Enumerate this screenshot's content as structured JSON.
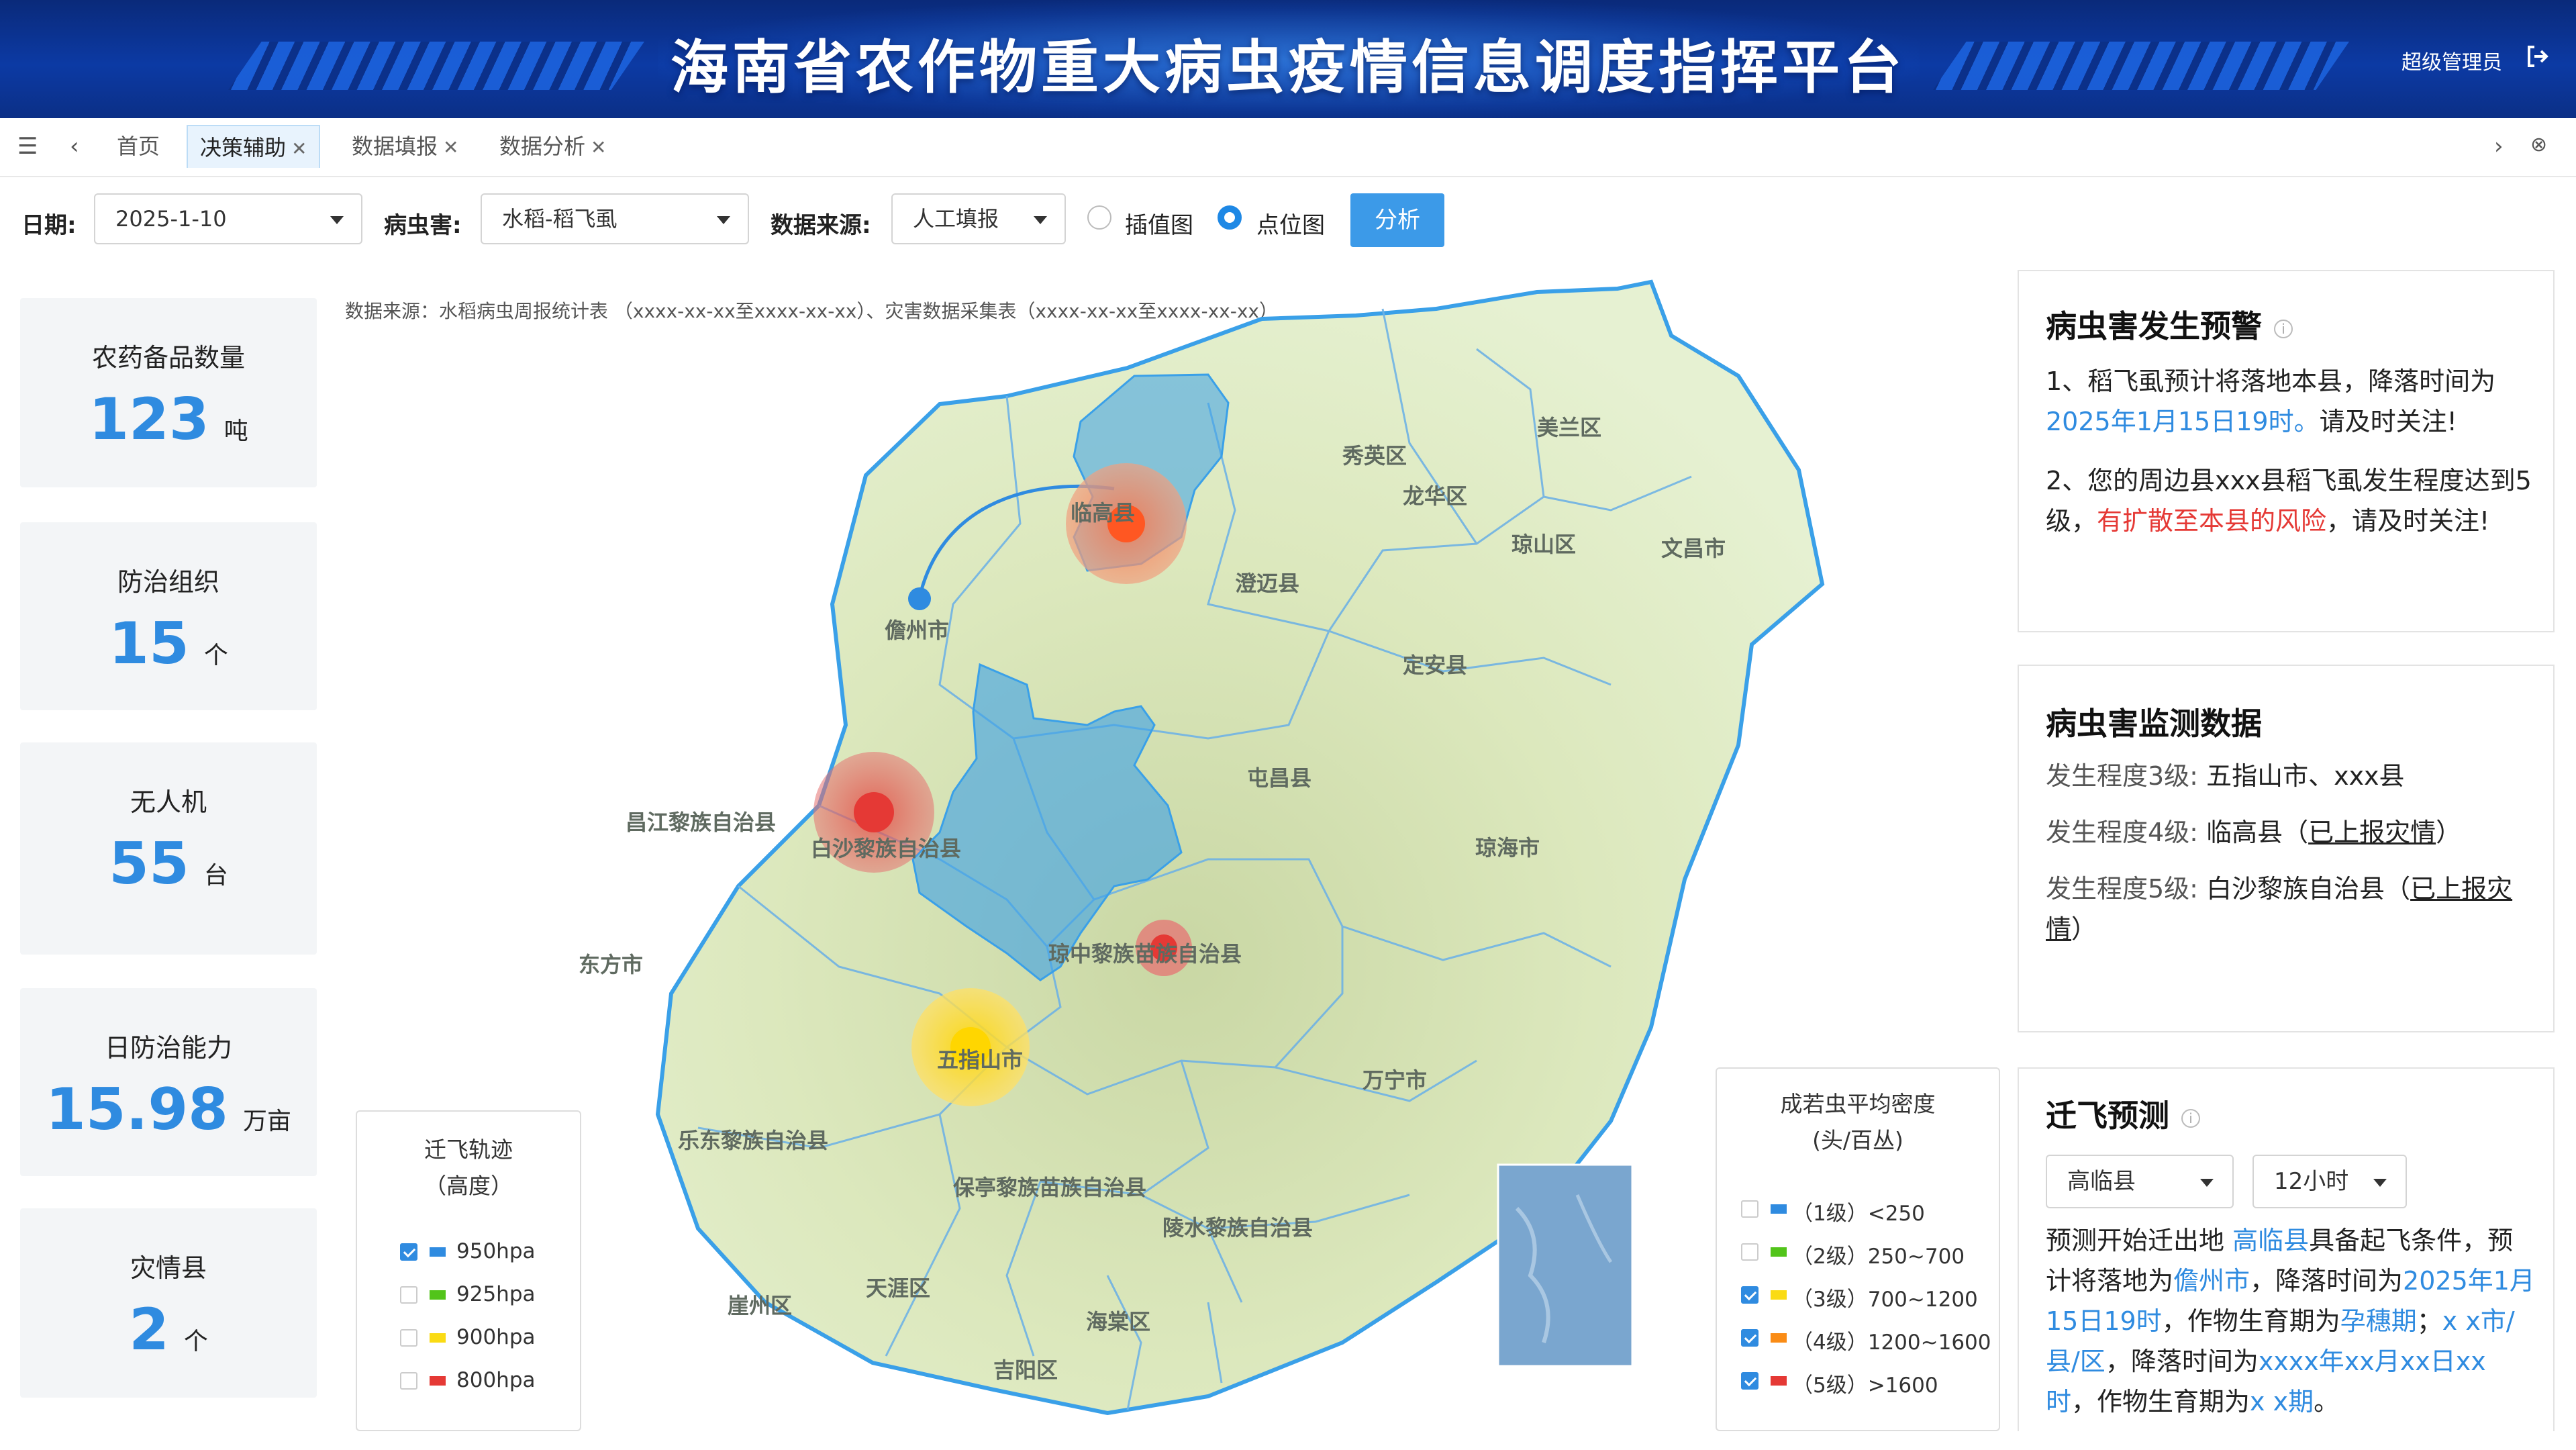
{
  "header": {
    "title": "海南省农作物重大病虫疫情信息调度指挥平台",
    "user": "超级管理员",
    "logout_icon": "logout-icon"
  },
  "tabs": {
    "items": [
      {
        "label": "首页",
        "closable": false,
        "active": false
      },
      {
        "label": "决策辅助",
        "closable": true,
        "active": true
      },
      {
        "label": "数据填报",
        "closable": true,
        "active": false
      },
      {
        "label": "数据分析",
        "closable": true,
        "active": false
      }
    ],
    "close_glyph": "✕"
  },
  "filters": {
    "date_label": "日期:",
    "date_value": "2025-1-10",
    "pest_label": "病虫害:",
    "pest_value": "水稻-稻飞虱",
    "source_label": "数据来源:",
    "source_value": "人工填报",
    "radio_interp": "插值图",
    "radio_point": "点位图",
    "selected_view": "点位图",
    "analyze_button": "分析"
  },
  "stats": [
    {
      "label": "农药备品数量",
      "value": "123",
      "unit": "吨"
    },
    {
      "label": "防治组织",
      "value": "15",
      "unit": "个"
    },
    {
      "label": "无人机",
      "value": "55",
      "unit": "台"
    },
    {
      "label": "日防治能力",
      "value": "15.98",
      "unit": "万亩"
    },
    {
      "label": "灾情县",
      "value": "2",
      "unit": "个"
    }
  ],
  "map": {
    "source_note": "数据来源：水稻病虫周报统计表 （xxxx-xx-xx至xxxx-xx-xx）、灾害数据采集表（xxxx-xx-xx至xxxx-xx-xx）",
    "regions": [
      "临高县",
      "儋州市",
      "秀英区",
      "龙华区",
      "美兰区",
      "琼山区",
      "文昌市",
      "澄迈县",
      "定安县",
      "屯昌县",
      "昌江黎族自治县",
      "白沙黎族自治县",
      "琼海市",
      "东方市",
      "琼中黎族苗族自治县",
      "五指山市",
      "万宁市",
      "乐东黎族自治县",
      "保亭黎族苗族自治县",
      "陵水黎族自治县",
      "崖州区",
      "天涯区",
      "海棠区",
      "吉阳区"
    ],
    "migration_legend": {
      "title_line1": "迁飞轨迹",
      "title_line2": "（高度）",
      "items": [
        {
          "label": "950hpa",
          "checked": true,
          "color": "#2f8be0"
        },
        {
          "label": "925hpa",
          "checked": false,
          "color": "#52c41a"
        },
        {
          "label": "900hpa",
          "checked": false,
          "color": "#fadb14"
        },
        {
          "label": "800hpa",
          "checked": false,
          "color": "#e53935"
        }
      ]
    },
    "density_legend": {
      "title_line1": "成若虫平均密度",
      "title_line2": "(头/百丛)",
      "items": [
        {
          "label": "（1级）<250",
          "checked": false,
          "color": "#2f8be0"
        },
        {
          "label": "（2级）250~700",
          "checked": false,
          "color": "#52c41a"
        },
        {
          "label": "（3级）700~1200",
          "checked": true,
          "color": "#fadb14"
        },
        {
          "label": "（4级）1200~1600",
          "checked": true,
          "color": "#fa8c16"
        },
        {
          "label": "（5级）>1600",
          "checked": true,
          "color": "#e53935"
        }
      ]
    }
  },
  "warning": {
    "title": "病虫害发生预警",
    "item1_pre": "1、稻飞虱预计将落地本县，降落时间为",
    "item1_time": "2025年1月15日19时。",
    "item1_post": "请及时关注!",
    "item2_pre": "2、您的周边县xxx县稻飞虱发生程度达到5级，",
    "item2_risk": "有扩散至本县的风险",
    "item2_post": "，请及时关注!"
  },
  "monitor": {
    "title": "病虫害监测数据",
    "rows": [
      {
        "level": "发生程度3级:",
        "text": "五指山市、xxx县",
        "link": "",
        "tail": ""
      },
      {
        "level": "发生程度4级:",
        "text": "临高县（",
        "link": "已上报灾情",
        "tail": "）"
      },
      {
        "level": "发生程度5级:",
        "text": "白沙黎族自治县（",
        "link": "已上报灾情",
        "tail": "）"
      }
    ]
  },
  "forecast": {
    "title": "迁飞预测",
    "select_county": "高临县",
    "select_hours": "12小时",
    "t1": "预测开始迁出地 ",
    "t2": "高临县",
    "t3": "具备起飞条件，预计将落地为",
    "t4": "儋州市",
    "t5": "，降落时间为",
    "t6": "2025年1月15日19时",
    "t7": "，作物生育期为",
    "t8": "孕穗期",
    "t9": "；",
    "t10": "x x市/县/区",
    "t11": "，降落时间为",
    "t12": "xxxx年xx月xx日xx时",
    "t13": "，作物生育期为",
    "t14": "x x期",
    "t15": "。"
  }
}
